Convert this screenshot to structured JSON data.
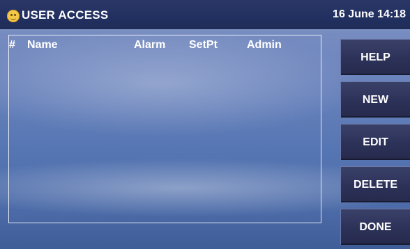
{
  "header": {
    "title": "USER ACCESS",
    "datetime": "16 June 14:18"
  },
  "table": {
    "columns": [
      "#",
      "Name",
      "Alarm",
      "SetPt",
      "Admin"
    ],
    "rows": []
  },
  "buttons": {
    "help": "HELP",
    "new": "NEW",
    "edit": "EDIT",
    "delete": "DELETE",
    "done": "DONE"
  },
  "icons": {
    "status": "smiley-icon"
  },
  "colors": {
    "header_bg": "#223061",
    "button_bg": "#2c3158",
    "panel_bg": "#5676b3",
    "smiley": "#f4c84a"
  }
}
